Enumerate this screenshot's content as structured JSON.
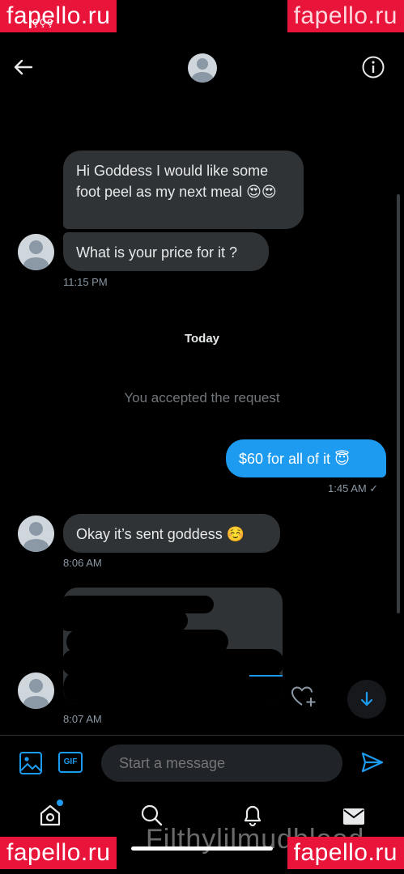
{
  "watermark": {
    "text": "fapello.ru"
  },
  "status_bar": {
    "text": "ççç"
  },
  "header": {
    "back_icon": "arrow-left-icon",
    "avatar_icon": "default-avatar-icon",
    "info_icon": "info-circle-icon"
  },
  "messages": {
    "m1": {
      "text": "Hi Goddess I would like some foot peel as my next meal 😍😍"
    },
    "m2": {
      "text": "What is your price for it ?",
      "time": "11:15 PM"
    },
    "day_label": "Today",
    "request_note": "You accepted the request",
    "m3": {
      "text": "$60 for all of it 😇",
      "time": "1:45 AM ✓"
    },
    "m4": {
      "text": "Okay it’s sent goddess ☺️",
      "time": "8:06 AM"
    },
    "m5": {
      "time": "8:07 AM",
      "reaction_icon": "heart-plus-icon"
    }
  },
  "scroll_button": {
    "icon": "arrow-down-icon"
  },
  "composer": {
    "placeholder": "Start a message",
    "gif_label": "GIF",
    "media_icon": "image-icon",
    "send_icon": "send-icon"
  },
  "bottom_nav": {
    "items": [
      "home-icon",
      "search-icon",
      "bell-icon",
      "mail-icon"
    ]
  },
  "overlay_text": "Filthylilmudblood",
  "colors": {
    "accent": "#1d9bf0",
    "bubble": "#2f3336",
    "background": "#000000",
    "watermark": "#e8143a"
  }
}
